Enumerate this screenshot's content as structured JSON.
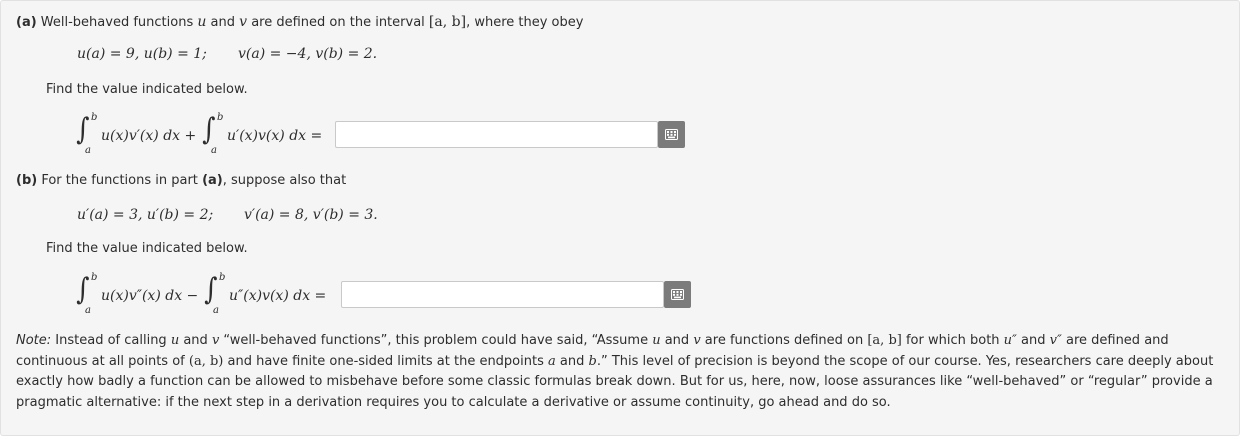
{
  "part_a": {
    "label": "(a)",
    "intro": "Well-behaved functions u and v are defined on the interval [a, b], where they obey",
    "intro_pre": "Well-behaved functions",
    "intro_u": "u",
    "intro_and": "and",
    "intro_v": "v",
    "intro_mid": "are defined on the interval",
    "intro_interval": "[a, b]",
    "intro_post": ", where they obey",
    "conditions_u": "u(a) = 9,  u(b) = 1;",
    "conditions_v": "v(a) = −4,  v(b) = 2.",
    "find": "Find the value indicated below.",
    "expr_term1": "u(x)v′(x) dx +",
    "expr_term2": "u′(x)v(x) dx =",
    "lower": "a",
    "upper": "b",
    "answer_value": ""
  },
  "part_b": {
    "label": "(b)",
    "intro_pre": "For the functions in part",
    "intro_ref": "(a)",
    "intro_post": ", suppose also that",
    "conditions_u": "u′(a) = 3,  u′(b) = 2;",
    "conditions_v": "v′(a) = 8,  v′(b) = 3.",
    "find": "Find the value indicated below.",
    "expr_term1": "u(x)v″(x) dx −",
    "expr_term2": "u″(x)v(x) dx =",
    "lower": "a",
    "upper": "b",
    "answer_value": ""
  },
  "note": {
    "label": "Note:",
    "text_1": " Instead of calling ",
    "u": "u",
    "text_2": " and ",
    "v": "v",
    "text_3": " “well-behaved functions”, this problem could have said, “Assume ",
    "text_4": " are functions defined on ",
    "interval": "[a, b]",
    "text_5": " for which both ",
    "u2": "u″",
    "text_6": " are defined and continuous at all points of ",
    "open_interval": "(a, b)",
    "text_7": " and have finite one-sided limits at the endpoints ",
    "a": "a",
    "b": "b",
    "text_8": ".” This level of precision is beyond the scope of our course. Yes, researchers care deeply about exactly how badly a function can be allowed to misbehave before some classic formulas break down. But for us, here, now, loose assurances like “well-behaved” or “regular” provide a pragmatic alternative: if the next step in a derivation requires you to calculate a derivative or assume continuity, go ahead and do so.",
    "v2": "v″"
  }
}
